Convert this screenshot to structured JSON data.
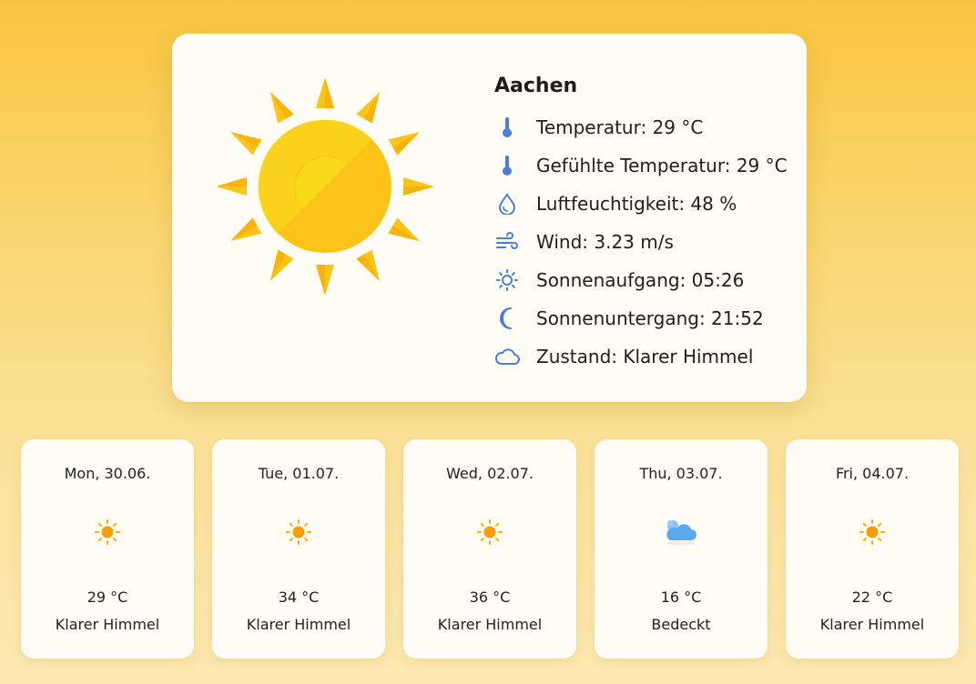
{
  "current": {
    "city": "Aachen",
    "condition_icon": "sun-icon",
    "details": [
      {
        "icon": "thermometer-icon",
        "text": "Temperatur: 29 °C"
      },
      {
        "icon": "thermometer-icon",
        "text": "Gefühlte Temperatur: 29 °C"
      },
      {
        "icon": "droplet-icon",
        "text": "Luftfeuchtigkeit: 48 %"
      },
      {
        "icon": "wind-icon",
        "text": "Wind: 3.23 m/s"
      },
      {
        "icon": "sunrise-icon",
        "text": "Sonnenaufgang: 05:26"
      },
      {
        "icon": "moon-icon",
        "text": "Sonnenuntergang: 21:52"
      },
      {
        "icon": "cloud-icon",
        "text": "Zustand: Klarer Himmel"
      }
    ]
  },
  "forecast": [
    {
      "date": "Mon, 30.06.",
      "icon": "sun-icon",
      "temp": "29 °C",
      "condition": "Klarer Himmel"
    },
    {
      "date": "Tue, 01.07.",
      "icon": "sun-icon",
      "temp": "34 °C",
      "condition": "Klarer Himmel"
    },
    {
      "date": "Wed, 02.07.",
      "icon": "sun-icon",
      "temp": "36 °C",
      "condition": "Klarer Himmel"
    },
    {
      "date": "Thu, 03.07.",
      "icon": "cloud-icon",
      "temp": "16 °C",
      "condition": "Bedeckt"
    },
    {
      "date": "Fri, 04.07.",
      "icon": "sun-icon",
      "temp": "22 °C",
      "condition": "Klarer Himmel"
    }
  ],
  "colors": {
    "icon_blue": "#4a7ed8",
    "sun_yellow": "#fcc419",
    "sun_orange": "#f59f00",
    "cloud_blue": "#5aa9f0"
  }
}
